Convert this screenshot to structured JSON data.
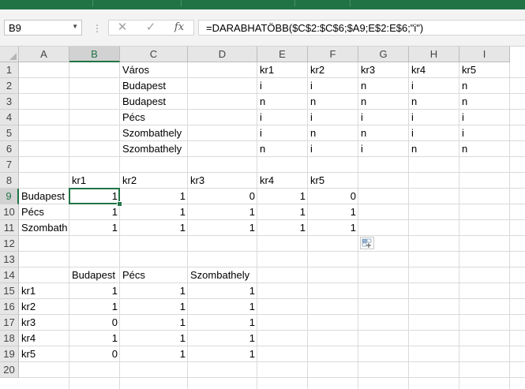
{
  "namebox": {
    "value": "B9"
  },
  "formula_bar": {
    "cancel_icon": "✕",
    "enter_icon": "✓",
    "fx_icon": "fx",
    "formula": "=DARABHATÖBB($C$2:$C$6;$A9;E$2:E$6;\"i\")"
  },
  "columns": [
    "A",
    "B",
    "C",
    "D",
    "E",
    "F",
    "G",
    "H",
    "I"
  ],
  "selected_cell": {
    "column": "B",
    "row": "9"
  },
  "rows": [
    {
      "n": "1",
      "cells": {
        "C": "Város",
        "E": "kr1",
        "F": "kr2",
        "G": "kr3",
        "H": "kr4",
        "I": "kr5"
      }
    },
    {
      "n": "2",
      "cells": {
        "C": "Budapest",
        "E": "i",
        "F": "i",
        "G": "n",
        "H": "i",
        "I": "n"
      }
    },
    {
      "n": "3",
      "cells": {
        "C": "Budapest",
        "E": "n",
        "F": "n",
        "G": "n",
        "H": "n",
        "I": "n"
      }
    },
    {
      "n": "4",
      "cells": {
        "C": "Pécs",
        "E": "i",
        "F": "i",
        "G": "i",
        "H": "i",
        "I": "i"
      }
    },
    {
      "n": "5",
      "cells": {
        "C": "Szombathely",
        "E": "i",
        "F": "n",
        "G": "n",
        "H": "i",
        "I": "i"
      }
    },
    {
      "n": "6",
      "cells": {
        "C": "Szombathely",
        "E": "n",
        "F": "i",
        "G": "i",
        "H": "n",
        "I": "n"
      }
    },
    {
      "n": "7",
      "cells": {}
    },
    {
      "n": "8",
      "cells": {
        "B": "kr1",
        "C": "kr2",
        "D": "kr3",
        "E": "kr4",
        "F": "kr5"
      }
    },
    {
      "n": "9",
      "cells": {
        "A": "Budapest",
        "B": 1,
        "C": 1,
        "D": 0,
        "E": 1,
        "F": 0
      }
    },
    {
      "n": "10",
      "cells": {
        "A": "Pécs",
        "B": 1,
        "C": 1,
        "D": 1,
        "E": 1,
        "F": 1
      }
    },
    {
      "n": "11",
      "cells": {
        "A": "Szombath",
        "B": 1,
        "C": 1,
        "D": 1,
        "E": 1,
        "F": 1
      }
    },
    {
      "n": "12",
      "cells": {}
    },
    {
      "n": "13",
      "cells": {}
    },
    {
      "n": "14",
      "cells": {
        "B": "Budapest",
        "C": "Pécs",
        "D": "Szombathely"
      }
    },
    {
      "n": "15",
      "cells": {
        "A": "kr1",
        "B": 1,
        "C": 1,
        "D": 1
      }
    },
    {
      "n": "16",
      "cells": {
        "A": "kr2",
        "B": 1,
        "C": 1,
        "D": 1
      }
    },
    {
      "n": "17",
      "cells": {
        "A": "kr3",
        "B": 0,
        "C": 1,
        "D": 1
      }
    },
    {
      "n": "18",
      "cells": {
        "A": "kr4",
        "B": 1,
        "C": 1,
        "D": 1
      }
    },
    {
      "n": "19",
      "cells": {
        "A": "kr5",
        "B": 0,
        "C": 1,
        "D": 1
      }
    },
    {
      "n": "20",
      "cells": {}
    }
  ],
  "colors": {
    "accent": "#217346",
    "gridline": "#dadada",
    "header_bg": "#e6e6e6"
  }
}
